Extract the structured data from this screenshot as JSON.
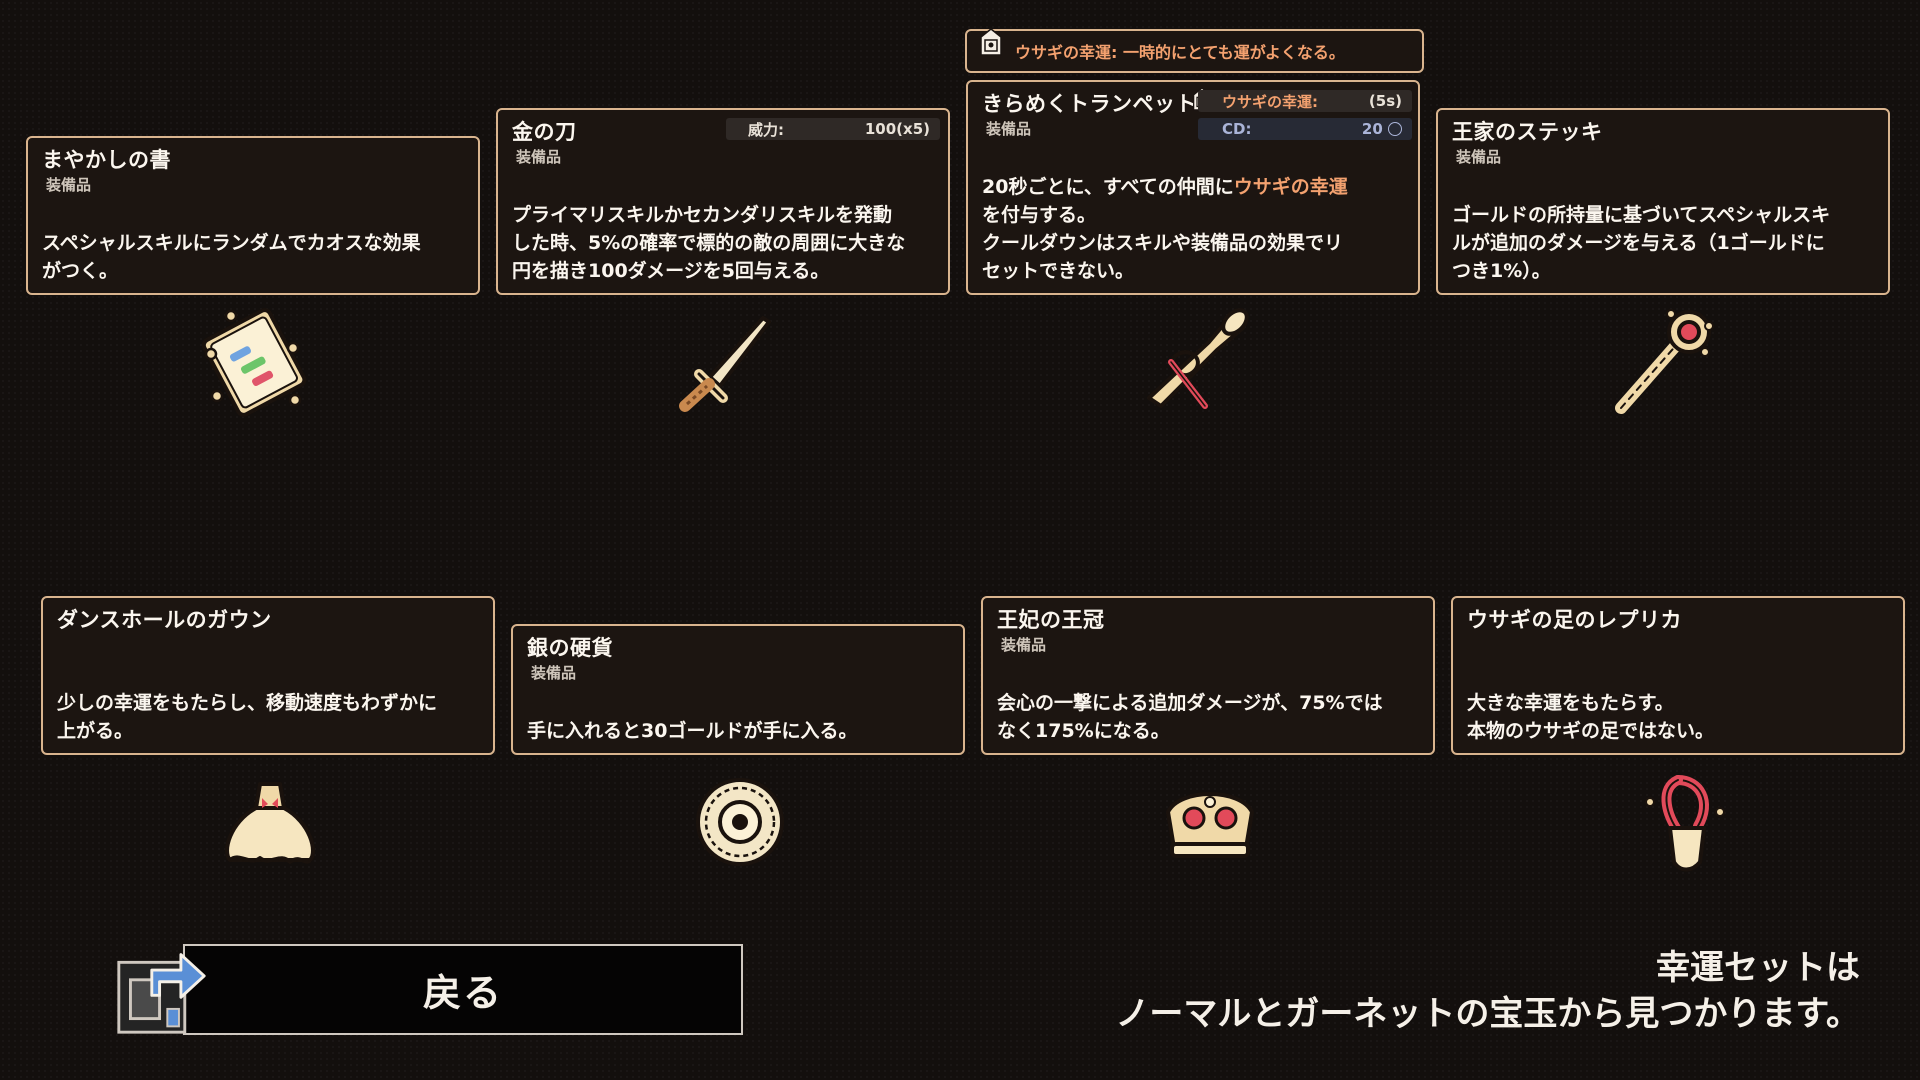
{
  "tooltip": {
    "text": "ウサギの幸運: 一時的にとても運がよくなる。"
  },
  "items": [
    {
      "name": "まやかしの書",
      "category": "装備品",
      "desc_lines": [
        "スペシャルスキルにランダムでカオスな効果",
        "がつく。"
      ],
      "icon": "spellbook-icon"
    },
    {
      "name": "金の刀",
      "category": "装備品",
      "stat": {
        "label": "威力:",
        "value": "100(x5)"
      },
      "desc_lines": [
        "プライマリスキルかセカンダリスキルを発動",
        "した時、5%の確率で標的の敵の周囲に大きな",
        "円を描き100ダメージを5回与える。"
      ],
      "icon": "golden-sword-icon"
    },
    {
      "name": "きらめくトランペット",
      "category": "装備品",
      "stat": {
        "label": "ウサギの幸運:",
        "value": "(5s)"
      },
      "cd": {
        "label": "CD:",
        "value": "20"
      },
      "desc_line1_a": "20秒ごとに、すべての仲間に",
      "desc_line1_hl": "ウサギの幸運",
      "desc_lines_rest": [
        "を付与する。",
        "クールダウンはスキルや装備品の効果でリ",
        "セットできない。"
      ],
      "icon": "trumpet-icon"
    },
    {
      "name": "王家のステッキ",
      "category": "装備品",
      "desc_lines": [
        "ゴールドの所持量に基づいてスペシャルスキ",
        "ルが追加のダメージを与える（1ゴールドに",
        "つき1%）。"
      ],
      "icon": "royal-cane-icon"
    },
    {
      "name": "ダンスホールのガウン",
      "category": "",
      "desc_lines": [
        "少しの幸運をもたらし、移動速度もわずかに",
        "上がる。"
      ],
      "icon": "ballroom-gown-icon"
    },
    {
      "name": "銀の硬貨",
      "category": "装備品",
      "desc_lines": [
        "手に入れると30ゴールドが手に入る。"
      ],
      "icon": "silver-coin-icon"
    },
    {
      "name": "王妃の王冠",
      "category": "装備品",
      "desc_lines": [
        "会心の一撃による追加ダメージが、75%では",
        "なく175%になる。"
      ],
      "icon": "queen-crown-icon"
    },
    {
      "name": "ウサギの足のレプリカ",
      "category": "",
      "desc_lines": [
        "大きな幸運をもたらす。",
        "本物のウサギの足ではない。"
      ],
      "icon": "rabbit-foot-icon"
    }
  ],
  "back_button": {
    "label": "戻る"
  },
  "hint": {
    "line1": "幸運セットは",
    "line2": "ノーマルとガーネットの宝玉から見つかります。"
  },
  "colors": {
    "card_border": "#d9b48e",
    "highlight": "#f3a16f",
    "background": "#130f0d"
  }
}
